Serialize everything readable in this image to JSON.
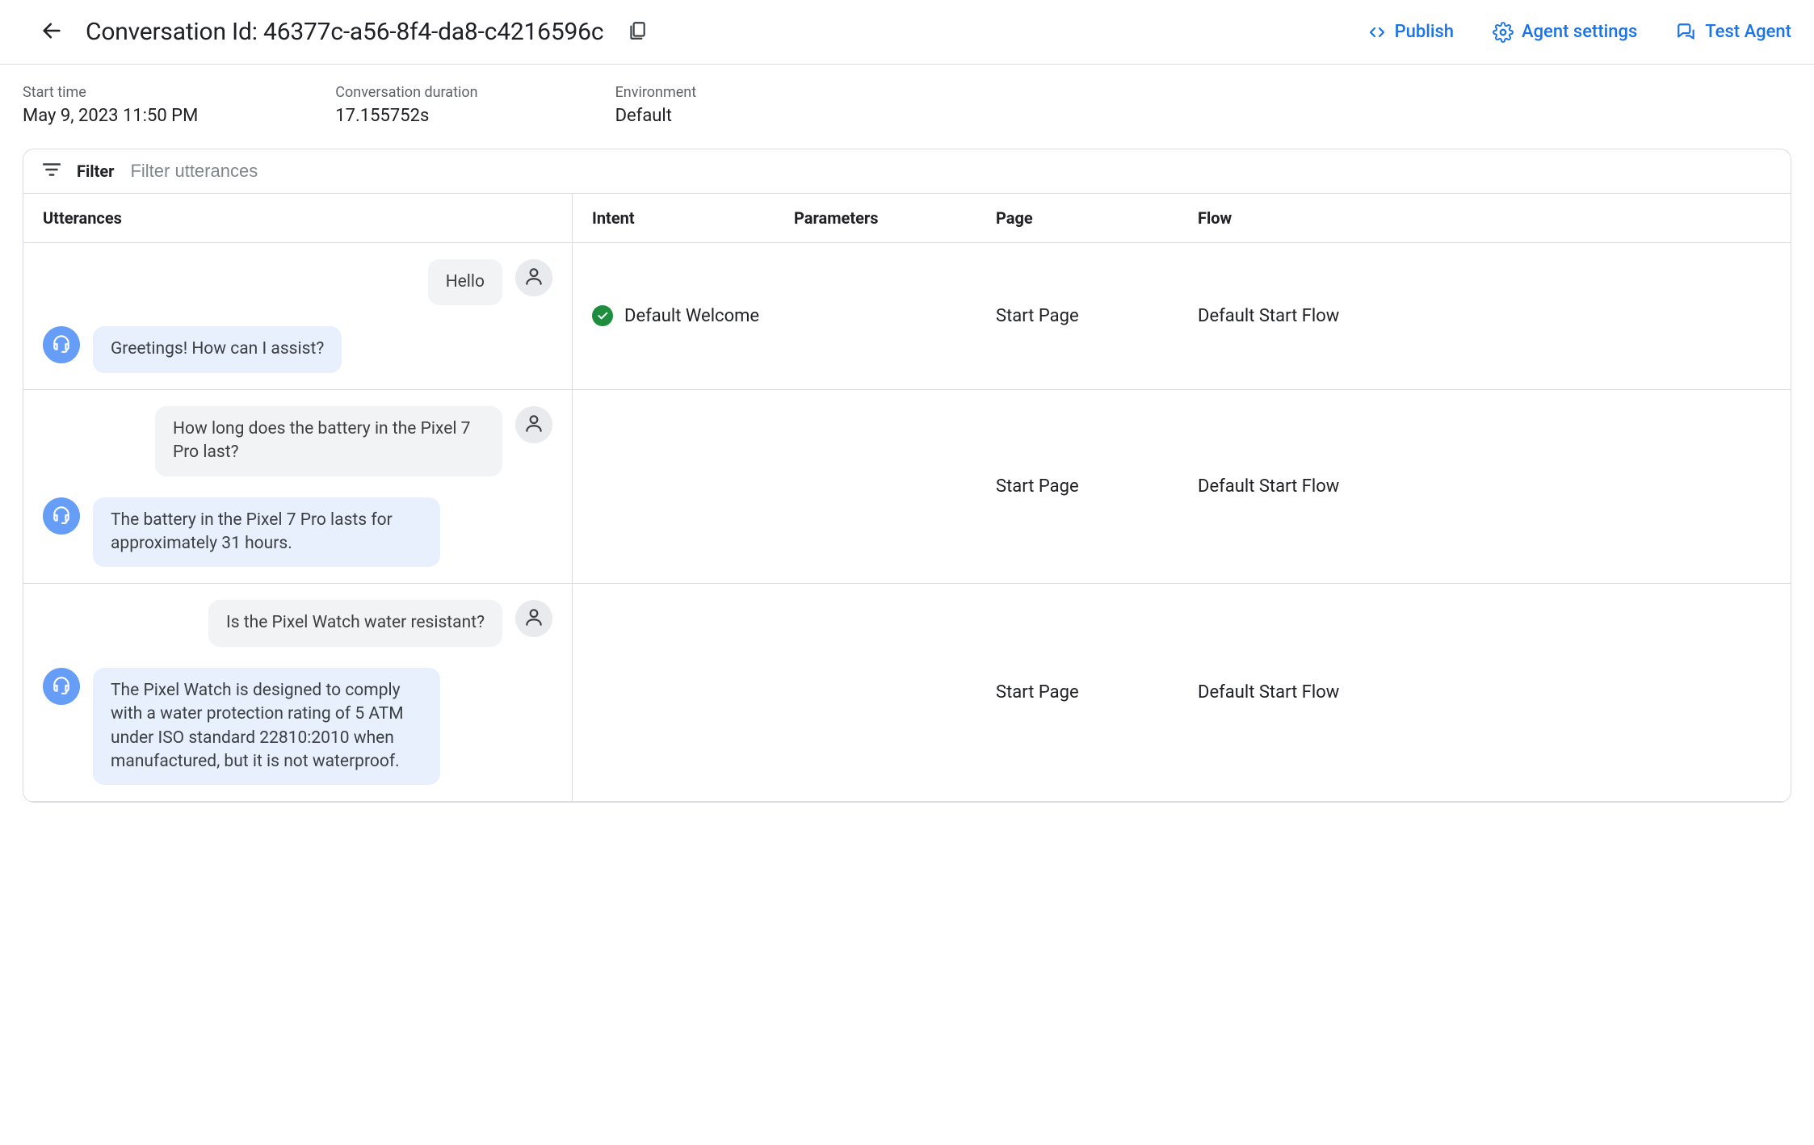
{
  "header": {
    "title": "Conversation Id: 46377c-a56-8f4-da8-c4216596c",
    "actions": {
      "publish": "Publish",
      "agent_settings": "Agent settings",
      "test_agent": "Test Agent"
    }
  },
  "meta": {
    "start_time_label": "Start time",
    "start_time_value": "May 9, 2023 11:50 PM",
    "duration_label": "Conversation duration",
    "duration_value": "17.155752s",
    "environment_label": "Environment",
    "environment_value": "Default"
  },
  "filter": {
    "label": "Filter",
    "placeholder": "Filter utterances"
  },
  "columns": {
    "utterances": "Utterances",
    "intent": "Intent",
    "parameters": "Parameters",
    "page": "Page",
    "flow": "Flow"
  },
  "rows": [
    {
      "user": "Hello",
      "agent": "Greetings! How can I assist?",
      "intent": "Default Welcome",
      "intent_matched": true,
      "parameters": "",
      "page": "Start Page",
      "flow": "Default Start Flow"
    },
    {
      "user": "How long does the battery in the Pixel 7 Pro last?",
      "agent": "The battery in the Pixel 7 Pro lasts for approximately 31 hours.",
      "intent": "",
      "intent_matched": false,
      "parameters": "",
      "page": "Start Page",
      "flow": "Default Start Flow"
    },
    {
      "user": "Is the Pixel Watch water resistant?",
      "agent": "The Pixel Watch is designed to comply with a water protection rating of 5 ATM under ISO standard 22810:2010 when manufactured, but it is not waterproof.",
      "intent": "",
      "intent_matched": false,
      "parameters": "",
      "page": "Start Page",
      "flow": "Default Start Flow"
    }
  ]
}
